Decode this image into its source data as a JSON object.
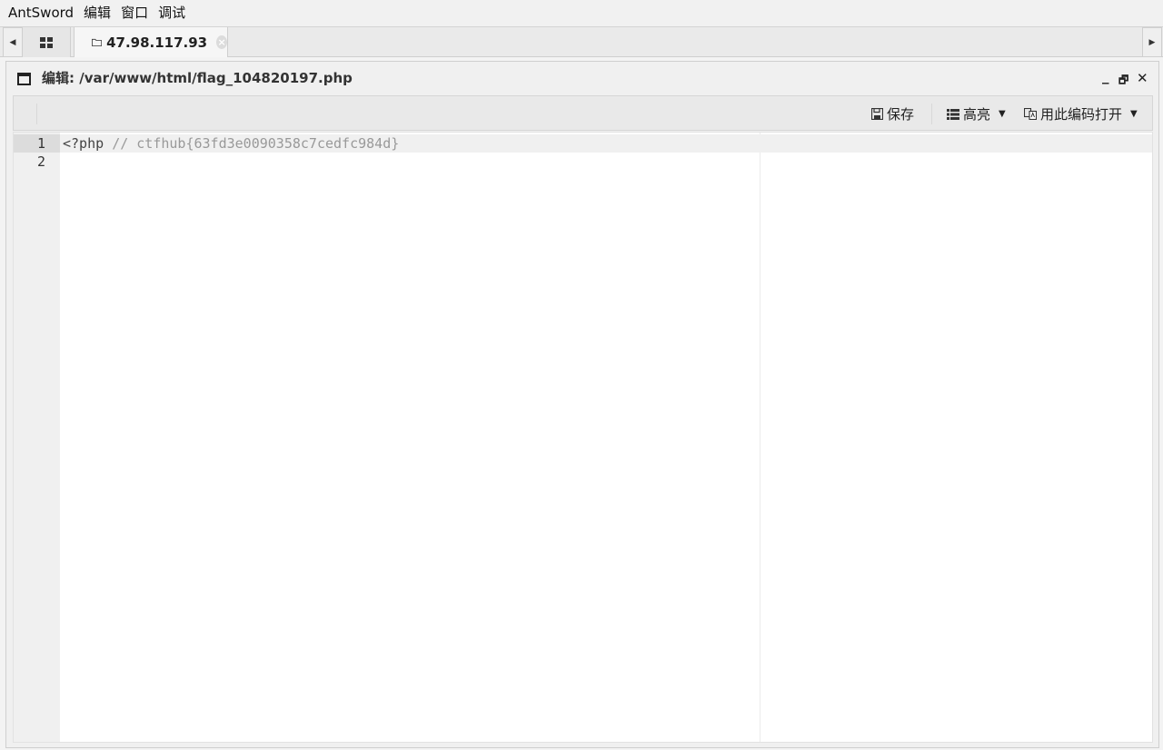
{
  "menubar": {
    "items": [
      "AntSword",
      "编辑",
      "窗口",
      "调试"
    ]
  },
  "tabs": {
    "host_label": "47.98.117.93",
    "close_glyph": "×",
    "home_icon": "grid-icon",
    "host_icon": "folder-icon"
  },
  "window": {
    "title": "编辑: /var/www/html/flag_104820197.php",
    "buttons": {
      "minimize": "_",
      "restore": "🗗",
      "close": "✕"
    }
  },
  "toolbar": {
    "save_label": "保存",
    "highlight_label": "高亮",
    "open_with_encoding_label": "用此编码打开"
  },
  "editor": {
    "lines": [
      {
        "number": "1",
        "keyword": "<?php",
        "comment": "// ctfhub{63fd3e0090358c7cedfc984d}"
      },
      {
        "number": "2",
        "keyword": "",
        "comment": ""
      }
    ]
  },
  "colors": {
    "comment": "#999999",
    "active_line": "#f0f0f0",
    "gutter": "#f0f0f0"
  }
}
